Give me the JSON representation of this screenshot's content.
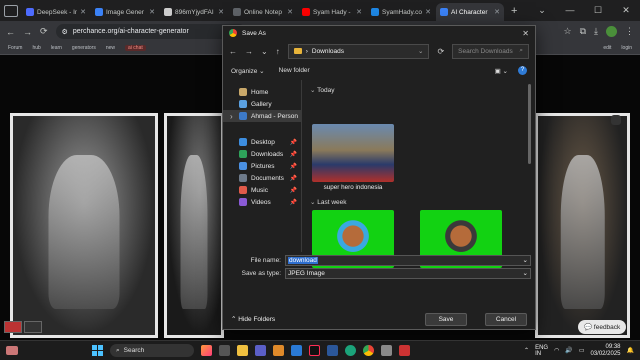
{
  "browser": {
    "tabs": [
      {
        "label": "DeepSeek - In",
        "color": "#4d6bfe",
        "active": false
      },
      {
        "label": "Image Gener",
        "color": "#3b82f6",
        "active": false
      },
      {
        "label": "896mYjydFAI",
        "color": "#cccccc",
        "active": false
      },
      {
        "label": "Online Notep",
        "color": "#5f6368",
        "active": false
      },
      {
        "label": "Syam Hady -",
        "color": "#ff0000",
        "active": false
      },
      {
        "label": "SyamHady.co",
        "color": "#1e88e5",
        "active": false
      },
      {
        "label": "AI Character",
        "color": "#3b82f6",
        "active": true
      }
    ],
    "url": "perchance.org/ai-character-generator",
    "bookmarks_left": [
      "Forum",
      "hub",
      "learn",
      "generators",
      "new",
      "ai chat"
    ],
    "bookmarks_right": [
      "edit",
      "login"
    ]
  },
  "dialog": {
    "title": "Save As",
    "location": "Downloads",
    "search_placeholder": "Search Downloads",
    "organize": "Organize",
    "new_folder": "New folder",
    "sidebar": [
      {
        "label": "Home",
        "color": "#c9a86a"
      },
      {
        "label": "Gallery",
        "color": "#5aa0e0"
      },
      {
        "label": "Ahmad - Person",
        "color": "#3d7ac9",
        "selected": true
      }
    ],
    "quick_access": [
      {
        "label": "Desktop",
        "color": "#3d8ee0"
      },
      {
        "label": "Downloads",
        "color": "#2ea25a"
      },
      {
        "label": "Pictures",
        "color": "#4a90e2"
      },
      {
        "label": "Documents",
        "color": "#6e7b8b"
      },
      {
        "label": "Music",
        "color": "#e05a4a"
      },
      {
        "label": "Videos",
        "color": "#8a5ad6"
      }
    ],
    "group_today": "Today",
    "group_last_week": "Last week",
    "files": [
      {
        "name": "super hero indonesia"
      }
    ],
    "file_name_label": "File name:",
    "file_name_value": "download",
    "save_type_label": "Save as type:",
    "save_type_value": "JPEG Image",
    "hide_folders": "Hide Folders",
    "save": "Save",
    "cancel": "Cancel"
  },
  "page": {
    "feedback": "feedback"
  },
  "taskbar": {
    "search": "Search",
    "lang": "ENG\nIN",
    "time": "09:38",
    "date": "03/02/2025"
  }
}
